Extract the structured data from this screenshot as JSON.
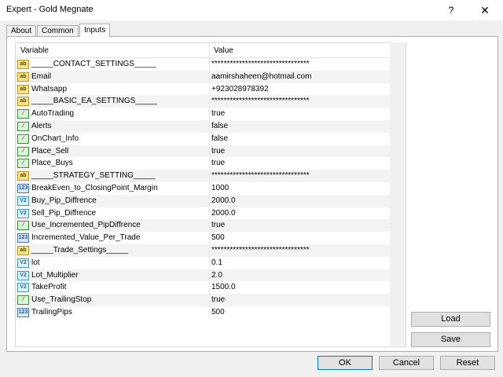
{
  "window": {
    "title": "Expert - Gold Megnate",
    "help_label": "?",
    "close_label": "✕"
  },
  "tabs": [
    {
      "label": "About"
    },
    {
      "label": "Common"
    },
    {
      "label": "Inputs"
    }
  ],
  "grid": {
    "headers": {
      "variable": "Variable",
      "value": "Value"
    },
    "rows": [
      {
        "type": "ab",
        "icon_text": "ab",
        "name": "_____CONTACT_SETTINGS_____",
        "value": "********************************"
      },
      {
        "type": "ab",
        "icon_text": "ab",
        "name": "Email",
        "value": "aamirshaheen@hotmail.com"
      },
      {
        "type": "ab",
        "icon_text": "ab",
        "name": "Whatsapp",
        "value": "+923028978392"
      },
      {
        "type": "ab",
        "icon_text": "ab",
        "name": "_____BASIC_EA_SETTINGS_____",
        "value": "********************************"
      },
      {
        "type": "bool",
        "icon_text": "⁄",
        "name": "AutoTrading",
        "value": "true"
      },
      {
        "type": "bool",
        "icon_text": "⁄",
        "name": "Alerts",
        "value": "false"
      },
      {
        "type": "bool",
        "icon_text": "⁄",
        "name": "OnChart_Info",
        "value": "false"
      },
      {
        "type": "bool",
        "icon_text": "⁄",
        "name": "Place_Sell",
        "value": "true"
      },
      {
        "type": "bool",
        "icon_text": "⁄",
        "name": "Place_Buys",
        "value": "true"
      },
      {
        "type": "ab",
        "icon_text": "ab",
        "name": "_____STRATEGY_SETTING_____",
        "value": "********************************"
      },
      {
        "type": "int",
        "icon_text": "123",
        "name": "BreakEven_to_ClosingPoint_Margin",
        "value": "1000"
      },
      {
        "type": "dbl",
        "icon_text": "V2",
        "name": "Buy_Pip_Diffrence",
        "value": "2000.0"
      },
      {
        "type": "dbl",
        "icon_text": "V2",
        "name": "Sell_Pip_Diffrence",
        "value": "2000.0"
      },
      {
        "type": "bool",
        "icon_text": "⁄",
        "name": "Use_Incremented_PipDiffrence",
        "value": "true"
      },
      {
        "type": "int",
        "icon_text": "123",
        "name": "Incremented_Value_Per_Trade",
        "value": "500"
      },
      {
        "type": "ab",
        "icon_text": "ab",
        "name": "_____Trade_Settings_____",
        "value": "********************************"
      },
      {
        "type": "dbl",
        "icon_text": "V2",
        "name": "lot",
        "value": "0.1"
      },
      {
        "type": "dbl",
        "icon_text": "V2",
        "name": "Lot_Multiplier",
        "value": "2.0"
      },
      {
        "type": "dbl",
        "icon_text": "V2",
        "name": "TakeProfit",
        "value": "1500.0"
      },
      {
        "type": "bool",
        "icon_text": "⁄",
        "name": "Use_TrailingStop",
        "value": "true"
      },
      {
        "type": "int",
        "icon_text": "123",
        "name": "TrailingPips",
        "value": "500"
      }
    ]
  },
  "side_buttons": {
    "load": "Load",
    "save": "Save"
  },
  "bottom_buttons": {
    "ok": "OK",
    "cancel": "Cancel",
    "reset": "Reset"
  }
}
